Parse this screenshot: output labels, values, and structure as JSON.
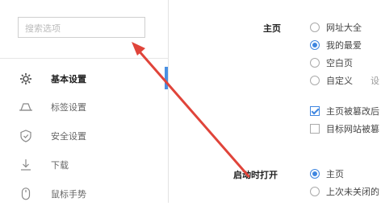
{
  "sidebar": {
    "search_placeholder": "搜索选项",
    "items": [
      {
        "label": "基本设置",
        "icon": "gear-icon",
        "active": true
      },
      {
        "label": "标签设置",
        "icon": "tab-icon",
        "active": false
      },
      {
        "label": "安全设置",
        "icon": "shield-icon",
        "active": false
      },
      {
        "label": "下载",
        "icon": "download-icon",
        "active": false
      },
      {
        "label": "鼠标手势",
        "icon": "mouse-icon",
        "active": false
      }
    ]
  },
  "main": {
    "homepage": {
      "title": "主页",
      "options": [
        {
          "label": "网址大全",
          "selected": false
        },
        {
          "label": "我的最爱",
          "selected": true
        },
        {
          "label": "空白页",
          "selected": false
        },
        {
          "label": "自定义",
          "selected": false
        }
      ],
      "custom_extra": "设",
      "checkboxes": [
        {
          "label": "主页被篡改后",
          "checked": true
        },
        {
          "label": "目标网站被篡",
          "checked": false
        }
      ]
    },
    "startup": {
      "title": "启动时打开",
      "options": [
        {
          "label": "主页",
          "selected": true
        },
        {
          "label": "上次未关闭的",
          "selected": false
        }
      ]
    }
  },
  "annotation": {
    "arrow_color": "#e0443a"
  }
}
